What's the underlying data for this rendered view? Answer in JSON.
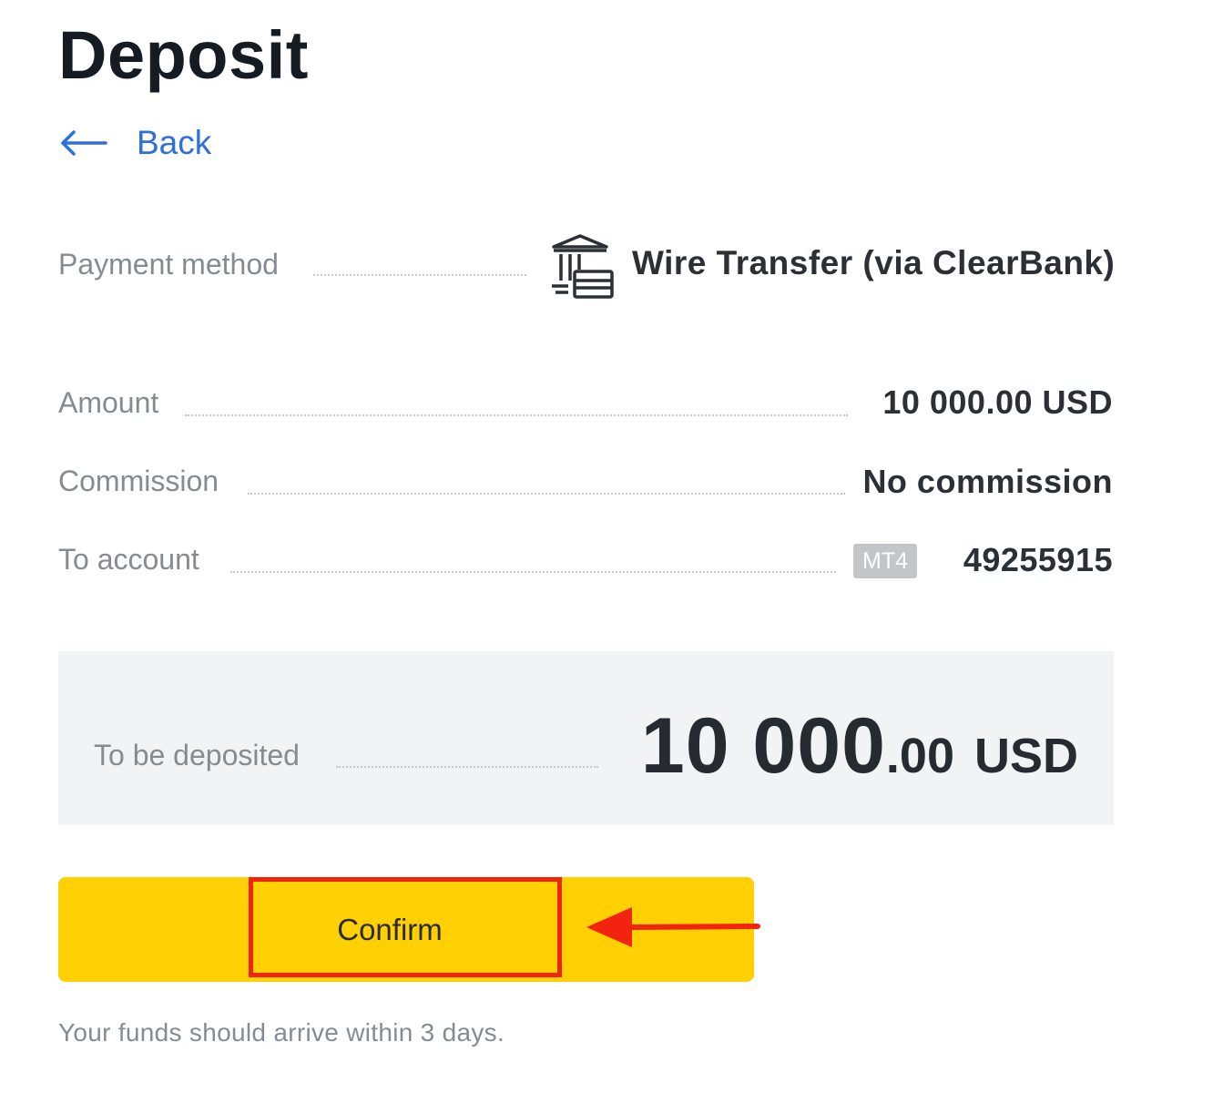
{
  "page": {
    "title": "Deposit"
  },
  "nav": {
    "back_label": "Back",
    "back_icon": "arrow-left-icon"
  },
  "payment": {
    "label": "Payment method",
    "value": "Wire Transfer (via ClearBank)",
    "icon": "bank-transfer-icon"
  },
  "details": {
    "amount_label": "Amount",
    "amount_value": "10 000.00 USD",
    "commission_label": "Commission",
    "commission_value": "No commission",
    "account_label": "To account",
    "account_badge": "MT4",
    "account_number": "49255915"
  },
  "summary": {
    "label": "To be deposited",
    "amount_integer": "10 000",
    "amount_decimal": ".00",
    "currency": "USD"
  },
  "actions": {
    "confirm_label": "Confirm"
  },
  "footer": {
    "note": "Your funds should arrive within 3 days."
  },
  "colors": {
    "accent_yellow": "#ffd004",
    "link_blue": "#2f6fdb",
    "annotation_red": "#f2230f",
    "label_gray": "#858c91",
    "panel_bg": "#f2f3f4"
  }
}
